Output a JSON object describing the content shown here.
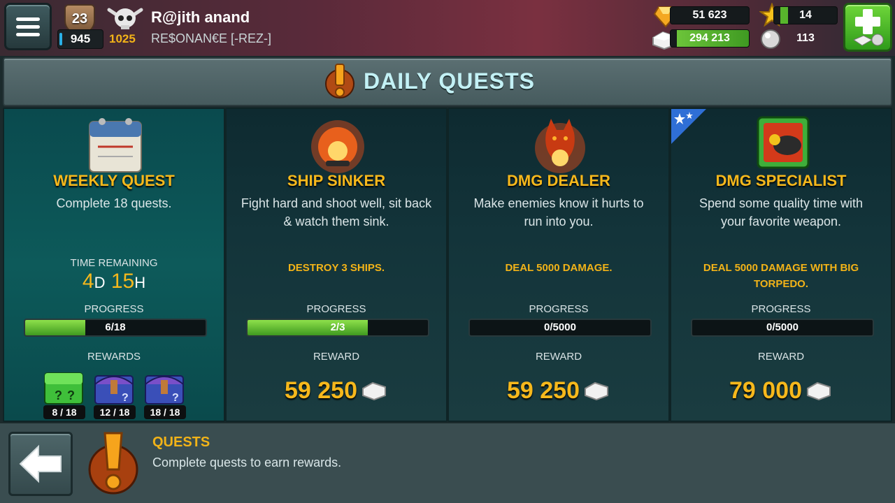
{
  "topbar": {
    "level": "23",
    "xp": "945",
    "rank_points": "1025",
    "player_name": "R@jith anand",
    "guild": "RE$ONAN€E [-REZ-]",
    "gems": "51 623",
    "silver": "294 213",
    "stars": "14",
    "pearls": "113"
  },
  "header": {
    "title": "DAILY QUESTS"
  },
  "cards": [
    {
      "title": "WEEKLY QUEST",
      "desc": "Complete 18 quests.",
      "time_label": "TIME REMAINING",
      "time_days": "4",
      "time_days_unit": "D",
      "time_hours": "15",
      "time_hours_unit": "H",
      "progress_label": "PROGRESS",
      "progress_text": "6/18",
      "progress_value": 0.333,
      "rewards_label": "REWARDS",
      "chests": [
        "8 / 18",
        "12 / 18",
        "18 / 18"
      ]
    },
    {
      "title": "SHIP SINKER",
      "desc": "Fight hard and shoot well, sit back & watch them sink.",
      "task": "DESTROY 3 SHIPS.",
      "progress_label": "PROGRESS",
      "progress_text": "2/3",
      "progress_value": 0.667,
      "reward_label": "REWARD",
      "reward": "59 250"
    },
    {
      "title": "DMG DEALER",
      "desc": "Make enemies know it hurts to run into you.",
      "task": "DEAL 5000 DAMAGE.",
      "progress_label": "PROGRESS",
      "progress_text": "0/5000",
      "progress_value": 0,
      "reward_label": "REWARD",
      "reward": "59 250"
    },
    {
      "title": "DMG SPECIALIST",
      "desc": "Spend some quality time with your favorite weapon.",
      "task": "DEAL 5000 DAMAGE WITH BIG TORPEDO.",
      "progress_label": "PROGRESS",
      "progress_text": "0/5000",
      "progress_value": 0,
      "reward_label": "REWARD",
      "reward": "79 000"
    }
  ],
  "footer": {
    "title": "QUESTS",
    "desc": "Complete quests to earn rewards."
  },
  "colors": {
    "accent_gold": "#f6b81c",
    "progress_green": "#6cc43a",
    "title_cyan": "#c3f1f5"
  }
}
